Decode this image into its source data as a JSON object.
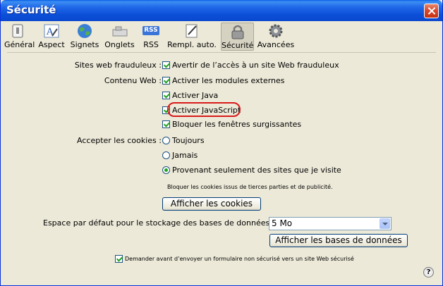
{
  "window": {
    "title": "Sécurité"
  },
  "toolbar": {
    "items": [
      {
        "label": "Général",
        "icon": "general-switch-icon"
      },
      {
        "label": "Aspect",
        "icon": "font-aspect-icon"
      },
      {
        "label": "Signets",
        "icon": "globe-bookmarks-icon"
      },
      {
        "label": "Onglets",
        "icon": "tabs-icon"
      },
      {
        "label": "RSS",
        "icon": "rss-icon"
      },
      {
        "label": "Rempl. auto.",
        "icon": "pen-autofill-icon"
      },
      {
        "label": "Sécurité",
        "icon": "lock-icon",
        "selected": true
      },
      {
        "label": "Avancées",
        "icon": "gear-icon"
      }
    ],
    "rss_badge": "RSS"
  },
  "fraud": {
    "label": "Sites web frauduleux :",
    "option": "Avertir de l’accès à un site Web frauduleux",
    "checked": true
  },
  "content": {
    "label": "Contenu Web :",
    "options": [
      {
        "text": "Activer les modules externes",
        "checked": true
      },
      {
        "text": "Activer Java",
        "checked": true
      },
      {
        "text": "Activer JavaScript",
        "checked": true
      },
      {
        "text": "Bloquer les fenêtres surgissantes",
        "checked": true
      }
    ]
  },
  "cookies": {
    "label": "Accepter les cookies :",
    "options": [
      {
        "text": "Toujours",
        "selected": false
      },
      {
        "text": "Jamais",
        "selected": false
      },
      {
        "text": "Provenant seulement des sites que je visite",
        "selected": true
      }
    ],
    "note": "Bloquer les cookies issus de tierces parties et de publicité.",
    "show_button": "Afficher les cookies"
  },
  "storage": {
    "label": "Espace par défaut pour le stockage des bases de données :",
    "value": "5 Mo",
    "show_button": "Afficher les bases de données"
  },
  "form_warning": {
    "text": "Demander avant d’envoyer un formulaire non sécurisé vers un site Web sécurisé",
    "checked": true
  },
  "help": {
    "symbol": "?"
  },
  "colors": {
    "title_bar": "#0a5fe6",
    "highlight": "#d81b1b",
    "check": "#21a121"
  }
}
